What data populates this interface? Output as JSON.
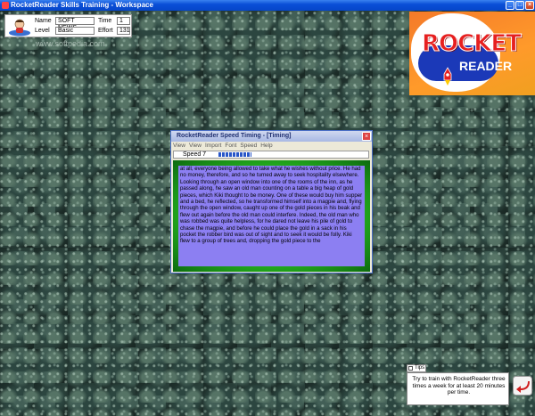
{
  "window": {
    "title": "RocketReader Skills Training - Workspace",
    "minimize_glyph": "_",
    "maximize_glyph": "□",
    "close_glyph": "×"
  },
  "info_panel": {
    "name_label": "Name",
    "name_value": "SOFT NEWS",
    "level_label": "Level",
    "level_value": "Basic",
    "time_label": "Time",
    "time_value": "1",
    "effort_label": "Effort",
    "effort_value": "131"
  },
  "watermark": "www.softpedia.com",
  "logo": {
    "word1": "ROCKET",
    "word2": "READER"
  },
  "speed_window": {
    "title": "RocketReader Speed Timing - [Timing]",
    "close_glyph": "×",
    "menu": [
      "View",
      "View",
      "Import",
      "Font",
      "Speed",
      "Help"
    ],
    "speed_label": "Speed 7",
    "speed_progress": 0.22,
    "text": "at all, everyone being allowed to take what he wishes without price. He had no money, therefore, and so he turned away to seek hospitality elsewhere. Looking through an open window into one of the rooms of the inn, as he passed along, he saw an old man counting on a table a big heap of gold pieces, which Kiki thought to be money. One of these would buy him supper and a bed, he reflected, so he transformed himself into a magpie and, flying through the open window, caught up one of the gold pieces in his beak and flew out again before the old man could interfere. Indeed, the old man who was robbed was quite helpless, for he dared not leave his pile of gold to chase the magpie, and before he could place the gold in a sack in his pocket the robber bird was out of sight and to seek it would be folly. Kiki flew to a group of trees and, dropping the gold piece to the"
  },
  "tips": {
    "tab_label": "Tips",
    "text": "Try to train with RocketReader three times a week for at least 20 minutes per time."
  },
  "colors": {
    "titlebar": "#0a4fd8",
    "reading_bg": "#8c7ff2",
    "frame_green": "#28b820",
    "logo_orange": "#ff8a2a",
    "logo_red": "#e62020",
    "logo_blue": "#1b39b8"
  },
  "icons": [
    "app-icon",
    "user-icon",
    "rocket-icon",
    "exit-arrow-icon",
    "close-icon",
    "minimize-icon",
    "maximize-icon"
  ]
}
